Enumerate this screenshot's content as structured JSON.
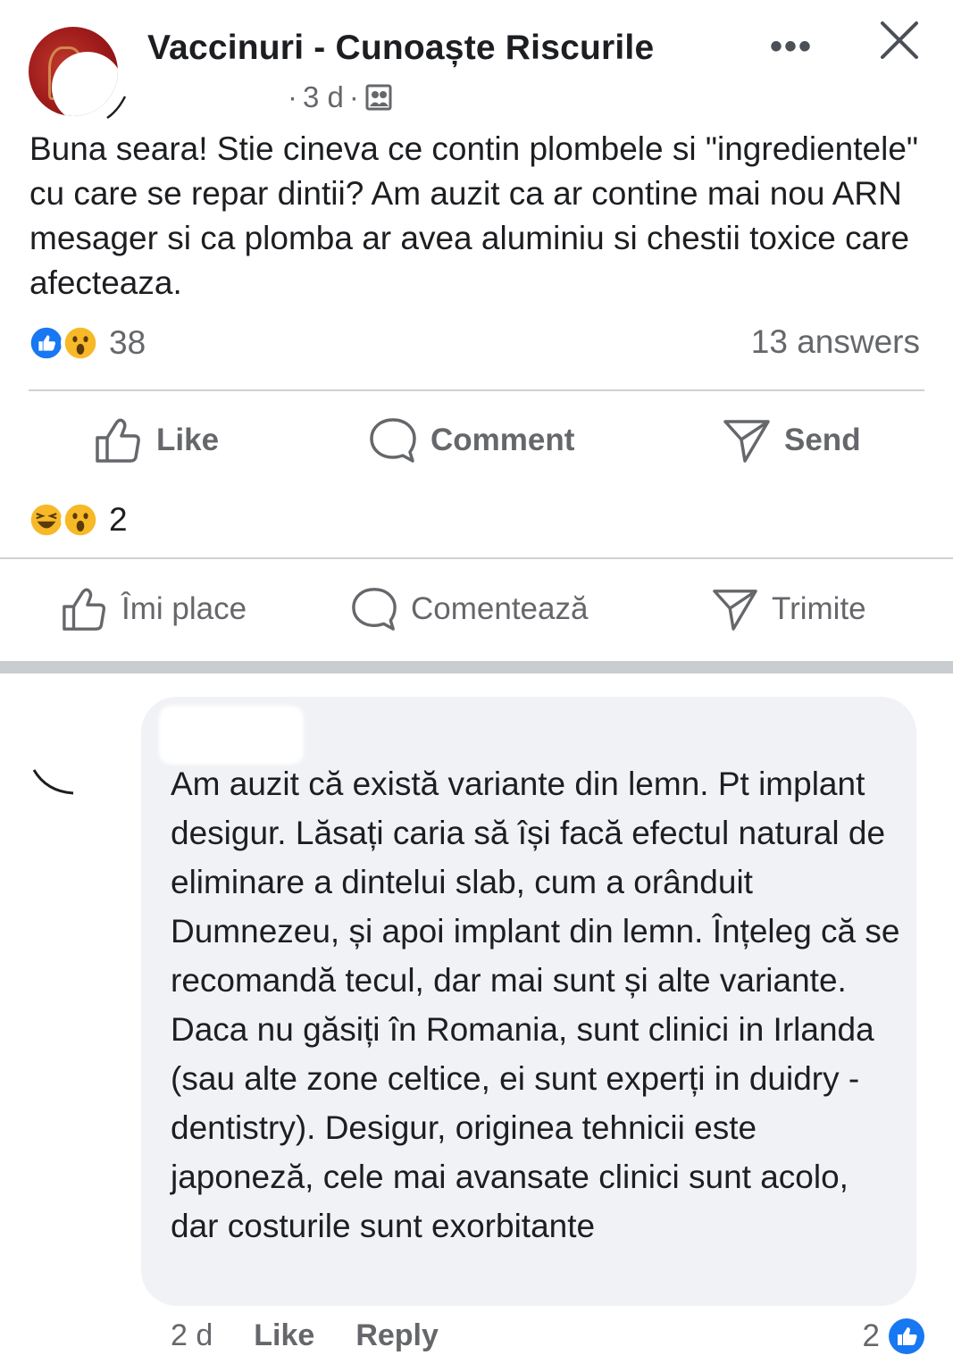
{
  "post": {
    "group_name": "Vaccinuri - Cunoaște Riscurile",
    "time_prefix": "·",
    "time": "3 d",
    "time_suffix": "·",
    "privacy_icon": "members-icon",
    "more_icon": "more-dots-icon",
    "more_label": "•••",
    "close_icon": "close-icon",
    "text": "Buna seara! Stie cineva ce contin plombele si \"ingredientele\" cu care se repar dintii? Am auzit ca ar contine mai nou ARN mesager si ca plomba ar avea aluminiu si chestii toxice care afecteaza.",
    "reaction_icons": [
      "like-icon",
      "wow-icon"
    ],
    "reaction_count": "38",
    "answers": "13 answers"
  },
  "actions_en": {
    "like": "Like",
    "comment": "Comment",
    "send": "Send"
  },
  "second_reactions": {
    "icons": [
      "haha-icon",
      "wow-icon"
    ],
    "count": "2"
  },
  "actions_ro": {
    "like": "Îmi place",
    "comment": "Comentează",
    "send": "Trimite"
  },
  "comment": {
    "text": "Am auzit că există variante din lemn. Pt implant desigur. Lăsați caria să își facă efectul natural de eliminare a dintelui slab, cum a orânduit Dumnezeu, și apoi implant din lemn. Înțeleg că se recomandă tecul, dar mai sunt și alte variante. Daca nu găsiți în Romania, sunt clinici in Irlanda (sau alte zone celtice, ei sunt experți in duidry - dentistry). Desigur, originea tehnicii este japoneză, cele mai avansate clinici sunt acolo, dar costurile sunt exorbitante",
    "time": "2 d",
    "like_label": "Like",
    "reply_label": "Reply",
    "like_count": "2"
  },
  "colors": {
    "like_blue": "#1877f2",
    "emoji_yellow": "#f7b928",
    "text": "#1c1e21",
    "secondary": "#65676b",
    "bubble": "#f0f2f5",
    "avatar_red": "#9e1b1b"
  }
}
